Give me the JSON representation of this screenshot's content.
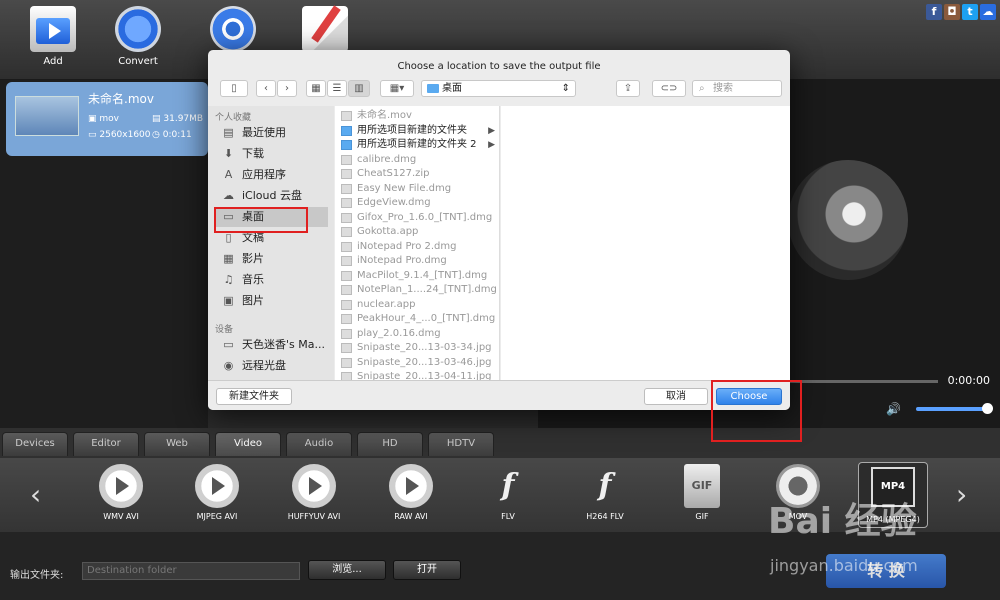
{
  "toolbar": {
    "add_label": "Add",
    "convert_label": "Convert"
  },
  "file": {
    "name": "未命名.mov",
    "format": "mov",
    "size": "31.97MB",
    "resolution": "2560x1600",
    "duration": "0:0:11"
  },
  "preview": {
    "time": "0:00:00",
    "volume_level": 0.9
  },
  "categories": [
    "Devices",
    "Editor",
    "Web",
    "Video",
    "Audio",
    "HD",
    "HDTV"
  ],
  "active_category": "Video",
  "formats": [
    {
      "label": "WMV AVI",
      "icon": "play-disc-icon"
    },
    {
      "label": "MJPEG AVI",
      "icon": "play-disc-icon"
    },
    {
      "label": "HUFFYUV AVI",
      "icon": "play-disc-icon"
    },
    {
      "label": "RAW AVI",
      "icon": "play-disc-icon"
    },
    {
      "label": "FLV",
      "icon": "flash-icon"
    },
    {
      "label": "H264 FLV",
      "icon": "flash-icon"
    },
    {
      "label": "GIF",
      "icon": "gif-file-icon"
    },
    {
      "label": "MOV",
      "icon": "quicktime-icon"
    },
    {
      "label": "MP4 (MPEG4)",
      "icon": "mp4-icon",
      "badge": "MP4"
    }
  ],
  "bottom": {
    "output_label": "输出文件夹:",
    "output_placeholder": "Destination folder",
    "browse_label": "浏览...",
    "open_label": "打开",
    "convert_label": "转 换"
  },
  "dialog": {
    "title": "Choose a location to save the output file",
    "path": "桌面",
    "search_placeholder": "搜索",
    "favorites_heading": "个人收藏",
    "favorites": [
      "最近使用",
      "下载",
      "应用程序",
      "iCloud 云盘",
      "桌面",
      "文稿",
      "影片",
      "音乐",
      "图片"
    ],
    "selected_favorite": "桌面",
    "devices_heading": "设备",
    "devices": [
      "天色迷香's Ma...",
      "远程光盘"
    ],
    "files": [
      {
        "name": "未命名.mov",
        "dir": false
      },
      {
        "name": "用所选项目新建的文件夹",
        "dir": true
      },
      {
        "name": "用所选项目新建的文件夹 2",
        "dir": true
      },
      {
        "name": "calibre.dmg",
        "dir": false
      },
      {
        "name": "CheatS127.zip",
        "dir": false
      },
      {
        "name": "Easy New File.dmg",
        "dir": false
      },
      {
        "name": "EdgeView.dmg",
        "dir": false
      },
      {
        "name": "Gifox_Pro_1.6.0_[TNT].dmg",
        "dir": false
      },
      {
        "name": "Gokotta.app",
        "dir": false
      },
      {
        "name": "iNotepad Pro 2.dmg",
        "dir": false
      },
      {
        "name": "iNotepad Pro.dmg",
        "dir": false
      },
      {
        "name": "MacPilot_9.1.4_[TNT].dmg",
        "dir": false
      },
      {
        "name": "NotePlan_1....24_[TNT].dmg",
        "dir": false
      },
      {
        "name": "nuclear.app",
        "dir": false
      },
      {
        "name": "PeakHour_4_...0_[TNT].dmg",
        "dir": false
      },
      {
        "name": "play_2.0.16.dmg",
        "dir": false
      },
      {
        "name": "Snipaste_20...13-03-34.jpg",
        "dir": false
      },
      {
        "name": "Snipaste_20...13-03-46.jpg",
        "dir": false
      },
      {
        "name": "Snipaste_20...13-04-11.jpg",
        "dir": false
      }
    ],
    "new_folder_label": "新建文件夹",
    "cancel_label": "取消",
    "choose_label": "Choose"
  },
  "watermark": {
    "brand": "Bai 经验",
    "url": "jingyan.baidu.com"
  },
  "colors": {
    "accent": "#2f82ea",
    "highlight_red": "#e02020"
  }
}
